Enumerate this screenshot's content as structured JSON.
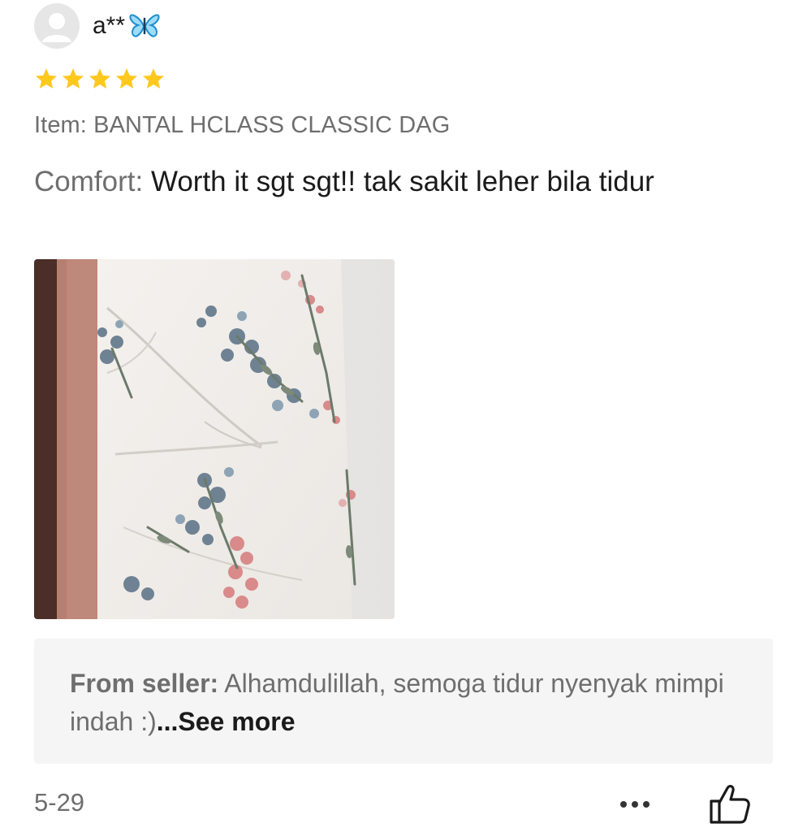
{
  "review": {
    "username": "a**",
    "username_emoji": "butterfly-icon",
    "rating": 5,
    "max_rating": 5,
    "item_label": "Item:",
    "item_value": "BANTAL HCLASS CLASSIC DAG",
    "comfort_label": "Comfort:",
    "comfort_text": "Worth it sgt sgt!! tak sakit leher bila tidur",
    "photo": "review-photo-floral-pillow",
    "seller_label": "From seller:",
    "seller_text": "Alhamdulillah, semoga tidur nyenyak mimpi indah :)",
    "see_more": "...See more",
    "date": "5-29",
    "more_icon": "more-dots-icon",
    "like_icon": "thumbs-up-icon"
  },
  "colors": {
    "star": "#ffc81e",
    "muted_text": "#6e6e6e",
    "primary_text": "#1a1a1a",
    "seller_bg": "#f5f5f5",
    "butterfly": "#2aa8e8"
  }
}
